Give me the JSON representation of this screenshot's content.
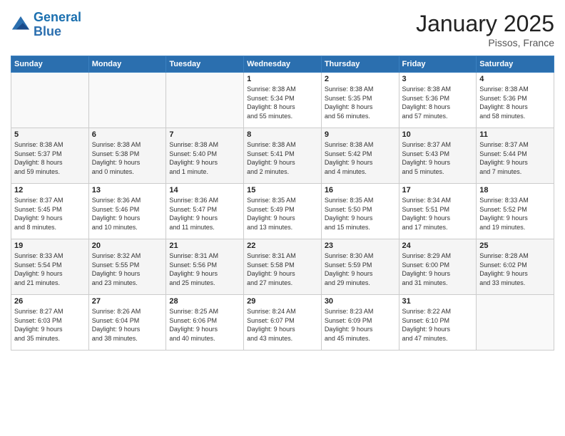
{
  "logo": {
    "line1": "General",
    "line2": "Blue"
  },
  "title": "January 2025",
  "location": "Pissos, France",
  "days_header": [
    "Sunday",
    "Monday",
    "Tuesday",
    "Wednesday",
    "Thursday",
    "Friday",
    "Saturday"
  ],
  "weeks": [
    [
      {
        "num": "",
        "info": ""
      },
      {
        "num": "",
        "info": ""
      },
      {
        "num": "",
        "info": ""
      },
      {
        "num": "1",
        "info": "Sunrise: 8:38 AM\nSunset: 5:34 PM\nDaylight: 8 hours\nand 55 minutes."
      },
      {
        "num": "2",
        "info": "Sunrise: 8:38 AM\nSunset: 5:35 PM\nDaylight: 8 hours\nand 56 minutes."
      },
      {
        "num": "3",
        "info": "Sunrise: 8:38 AM\nSunset: 5:36 PM\nDaylight: 8 hours\nand 57 minutes."
      },
      {
        "num": "4",
        "info": "Sunrise: 8:38 AM\nSunset: 5:36 PM\nDaylight: 8 hours\nand 58 minutes."
      }
    ],
    [
      {
        "num": "5",
        "info": "Sunrise: 8:38 AM\nSunset: 5:37 PM\nDaylight: 8 hours\nand 59 minutes."
      },
      {
        "num": "6",
        "info": "Sunrise: 8:38 AM\nSunset: 5:38 PM\nDaylight: 9 hours\nand 0 minutes."
      },
      {
        "num": "7",
        "info": "Sunrise: 8:38 AM\nSunset: 5:40 PM\nDaylight: 9 hours\nand 1 minute."
      },
      {
        "num": "8",
        "info": "Sunrise: 8:38 AM\nSunset: 5:41 PM\nDaylight: 9 hours\nand 2 minutes."
      },
      {
        "num": "9",
        "info": "Sunrise: 8:38 AM\nSunset: 5:42 PM\nDaylight: 9 hours\nand 4 minutes."
      },
      {
        "num": "10",
        "info": "Sunrise: 8:37 AM\nSunset: 5:43 PM\nDaylight: 9 hours\nand 5 minutes."
      },
      {
        "num": "11",
        "info": "Sunrise: 8:37 AM\nSunset: 5:44 PM\nDaylight: 9 hours\nand 7 minutes."
      }
    ],
    [
      {
        "num": "12",
        "info": "Sunrise: 8:37 AM\nSunset: 5:45 PM\nDaylight: 9 hours\nand 8 minutes."
      },
      {
        "num": "13",
        "info": "Sunrise: 8:36 AM\nSunset: 5:46 PM\nDaylight: 9 hours\nand 10 minutes."
      },
      {
        "num": "14",
        "info": "Sunrise: 8:36 AM\nSunset: 5:47 PM\nDaylight: 9 hours\nand 11 minutes."
      },
      {
        "num": "15",
        "info": "Sunrise: 8:35 AM\nSunset: 5:49 PM\nDaylight: 9 hours\nand 13 minutes."
      },
      {
        "num": "16",
        "info": "Sunrise: 8:35 AM\nSunset: 5:50 PM\nDaylight: 9 hours\nand 15 minutes."
      },
      {
        "num": "17",
        "info": "Sunrise: 8:34 AM\nSunset: 5:51 PM\nDaylight: 9 hours\nand 17 minutes."
      },
      {
        "num": "18",
        "info": "Sunrise: 8:33 AM\nSunset: 5:52 PM\nDaylight: 9 hours\nand 19 minutes."
      }
    ],
    [
      {
        "num": "19",
        "info": "Sunrise: 8:33 AM\nSunset: 5:54 PM\nDaylight: 9 hours\nand 21 minutes."
      },
      {
        "num": "20",
        "info": "Sunrise: 8:32 AM\nSunset: 5:55 PM\nDaylight: 9 hours\nand 23 minutes."
      },
      {
        "num": "21",
        "info": "Sunrise: 8:31 AM\nSunset: 5:56 PM\nDaylight: 9 hours\nand 25 minutes."
      },
      {
        "num": "22",
        "info": "Sunrise: 8:31 AM\nSunset: 5:58 PM\nDaylight: 9 hours\nand 27 minutes."
      },
      {
        "num": "23",
        "info": "Sunrise: 8:30 AM\nSunset: 5:59 PM\nDaylight: 9 hours\nand 29 minutes."
      },
      {
        "num": "24",
        "info": "Sunrise: 8:29 AM\nSunset: 6:00 PM\nDaylight: 9 hours\nand 31 minutes."
      },
      {
        "num": "25",
        "info": "Sunrise: 8:28 AM\nSunset: 6:02 PM\nDaylight: 9 hours\nand 33 minutes."
      }
    ],
    [
      {
        "num": "26",
        "info": "Sunrise: 8:27 AM\nSunset: 6:03 PM\nDaylight: 9 hours\nand 35 minutes."
      },
      {
        "num": "27",
        "info": "Sunrise: 8:26 AM\nSunset: 6:04 PM\nDaylight: 9 hours\nand 38 minutes."
      },
      {
        "num": "28",
        "info": "Sunrise: 8:25 AM\nSunset: 6:06 PM\nDaylight: 9 hours\nand 40 minutes."
      },
      {
        "num": "29",
        "info": "Sunrise: 8:24 AM\nSunset: 6:07 PM\nDaylight: 9 hours\nand 43 minutes."
      },
      {
        "num": "30",
        "info": "Sunrise: 8:23 AM\nSunset: 6:09 PM\nDaylight: 9 hours\nand 45 minutes."
      },
      {
        "num": "31",
        "info": "Sunrise: 8:22 AM\nSunset: 6:10 PM\nDaylight: 9 hours\nand 47 minutes."
      },
      {
        "num": "",
        "info": ""
      }
    ]
  ]
}
